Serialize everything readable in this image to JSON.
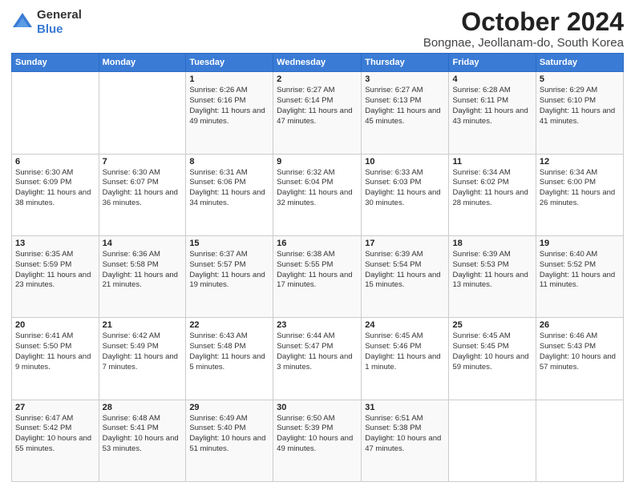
{
  "header": {
    "logo": {
      "general": "General",
      "blue": "Blue"
    },
    "title": "October 2024",
    "subtitle": "Bongnae, Jeollanam-do, South Korea"
  },
  "days_of_week": [
    "Sunday",
    "Monday",
    "Tuesday",
    "Wednesday",
    "Thursday",
    "Friday",
    "Saturday"
  ],
  "weeks": [
    [
      {
        "day": "",
        "info": ""
      },
      {
        "day": "",
        "info": ""
      },
      {
        "day": "1",
        "info": "Sunrise: 6:26 AM\nSunset: 6:16 PM\nDaylight: 11 hours and 49 minutes."
      },
      {
        "day": "2",
        "info": "Sunrise: 6:27 AM\nSunset: 6:14 PM\nDaylight: 11 hours and 47 minutes."
      },
      {
        "day": "3",
        "info": "Sunrise: 6:27 AM\nSunset: 6:13 PM\nDaylight: 11 hours and 45 minutes."
      },
      {
        "day": "4",
        "info": "Sunrise: 6:28 AM\nSunset: 6:11 PM\nDaylight: 11 hours and 43 minutes."
      },
      {
        "day": "5",
        "info": "Sunrise: 6:29 AM\nSunset: 6:10 PM\nDaylight: 11 hours and 41 minutes."
      }
    ],
    [
      {
        "day": "6",
        "info": "Sunrise: 6:30 AM\nSunset: 6:09 PM\nDaylight: 11 hours and 38 minutes."
      },
      {
        "day": "7",
        "info": "Sunrise: 6:30 AM\nSunset: 6:07 PM\nDaylight: 11 hours and 36 minutes."
      },
      {
        "day": "8",
        "info": "Sunrise: 6:31 AM\nSunset: 6:06 PM\nDaylight: 11 hours and 34 minutes."
      },
      {
        "day": "9",
        "info": "Sunrise: 6:32 AM\nSunset: 6:04 PM\nDaylight: 11 hours and 32 minutes."
      },
      {
        "day": "10",
        "info": "Sunrise: 6:33 AM\nSunset: 6:03 PM\nDaylight: 11 hours and 30 minutes."
      },
      {
        "day": "11",
        "info": "Sunrise: 6:34 AM\nSunset: 6:02 PM\nDaylight: 11 hours and 28 minutes."
      },
      {
        "day": "12",
        "info": "Sunrise: 6:34 AM\nSunset: 6:00 PM\nDaylight: 11 hours and 26 minutes."
      }
    ],
    [
      {
        "day": "13",
        "info": "Sunrise: 6:35 AM\nSunset: 5:59 PM\nDaylight: 11 hours and 23 minutes."
      },
      {
        "day": "14",
        "info": "Sunrise: 6:36 AM\nSunset: 5:58 PM\nDaylight: 11 hours and 21 minutes."
      },
      {
        "day": "15",
        "info": "Sunrise: 6:37 AM\nSunset: 5:57 PM\nDaylight: 11 hours and 19 minutes."
      },
      {
        "day": "16",
        "info": "Sunrise: 6:38 AM\nSunset: 5:55 PM\nDaylight: 11 hours and 17 minutes."
      },
      {
        "day": "17",
        "info": "Sunrise: 6:39 AM\nSunset: 5:54 PM\nDaylight: 11 hours and 15 minutes."
      },
      {
        "day": "18",
        "info": "Sunrise: 6:39 AM\nSunset: 5:53 PM\nDaylight: 11 hours and 13 minutes."
      },
      {
        "day": "19",
        "info": "Sunrise: 6:40 AM\nSunset: 5:52 PM\nDaylight: 11 hours and 11 minutes."
      }
    ],
    [
      {
        "day": "20",
        "info": "Sunrise: 6:41 AM\nSunset: 5:50 PM\nDaylight: 11 hours and 9 minutes."
      },
      {
        "day": "21",
        "info": "Sunrise: 6:42 AM\nSunset: 5:49 PM\nDaylight: 11 hours and 7 minutes."
      },
      {
        "day": "22",
        "info": "Sunrise: 6:43 AM\nSunset: 5:48 PM\nDaylight: 11 hours and 5 minutes."
      },
      {
        "day": "23",
        "info": "Sunrise: 6:44 AM\nSunset: 5:47 PM\nDaylight: 11 hours and 3 minutes."
      },
      {
        "day": "24",
        "info": "Sunrise: 6:45 AM\nSunset: 5:46 PM\nDaylight: 11 hours and 1 minute."
      },
      {
        "day": "25",
        "info": "Sunrise: 6:45 AM\nSunset: 5:45 PM\nDaylight: 10 hours and 59 minutes."
      },
      {
        "day": "26",
        "info": "Sunrise: 6:46 AM\nSunset: 5:43 PM\nDaylight: 10 hours and 57 minutes."
      }
    ],
    [
      {
        "day": "27",
        "info": "Sunrise: 6:47 AM\nSunset: 5:42 PM\nDaylight: 10 hours and 55 minutes."
      },
      {
        "day": "28",
        "info": "Sunrise: 6:48 AM\nSunset: 5:41 PM\nDaylight: 10 hours and 53 minutes."
      },
      {
        "day": "29",
        "info": "Sunrise: 6:49 AM\nSunset: 5:40 PM\nDaylight: 10 hours and 51 minutes."
      },
      {
        "day": "30",
        "info": "Sunrise: 6:50 AM\nSunset: 5:39 PM\nDaylight: 10 hours and 49 minutes."
      },
      {
        "day": "31",
        "info": "Sunrise: 6:51 AM\nSunset: 5:38 PM\nDaylight: 10 hours and 47 minutes."
      },
      {
        "day": "",
        "info": ""
      },
      {
        "day": "",
        "info": ""
      }
    ]
  ]
}
